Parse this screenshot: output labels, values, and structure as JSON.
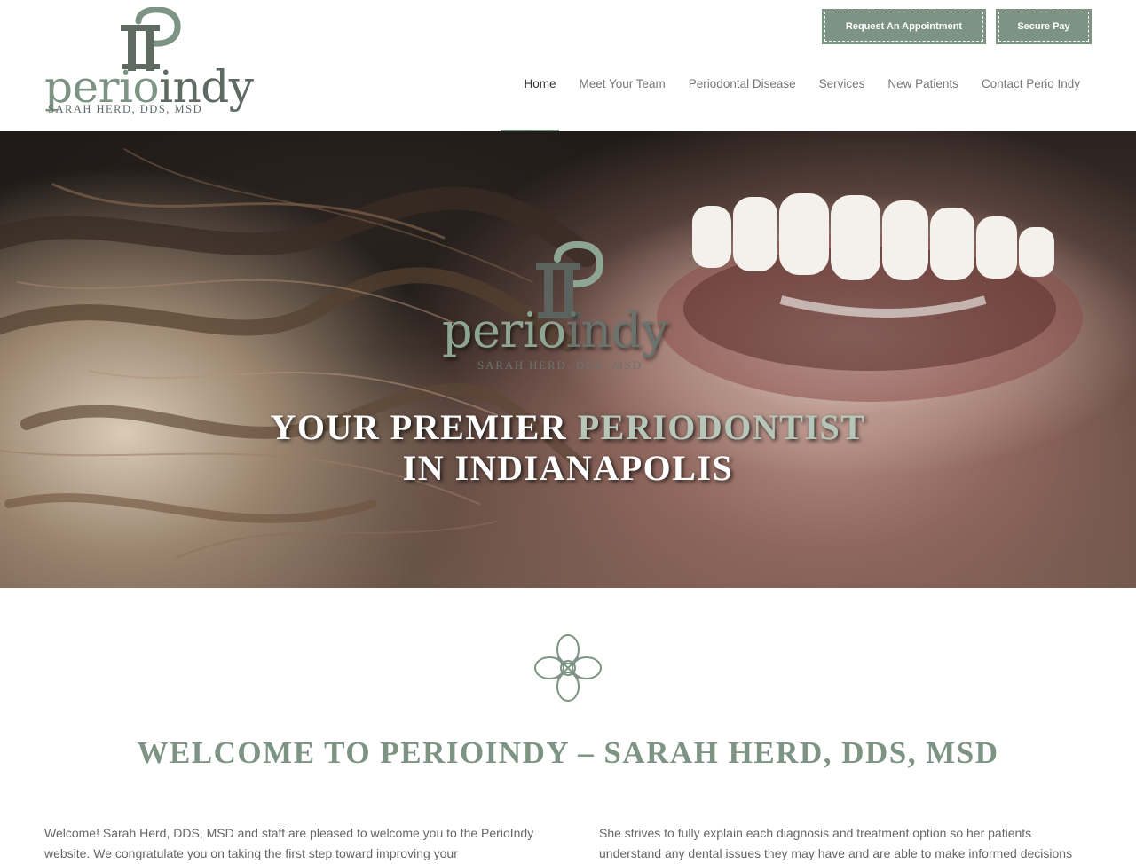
{
  "brand": {
    "logo_word_perio": "perio",
    "logo_word_indy": "indy",
    "logo_sub": "SARAH HERD, DDS, MSD",
    "primary_color": "#7d9384",
    "dark_color": "#5f6a63"
  },
  "header": {
    "appointment_label": "Request An Appointment",
    "secure_pay_label": "Secure Pay"
  },
  "nav": {
    "items": [
      {
        "label": "Home",
        "active": true
      },
      {
        "label": "Meet Your Team",
        "active": false
      },
      {
        "label": "Periodontal Disease",
        "active": false
      },
      {
        "label": "Services",
        "active": false
      },
      {
        "label": "New Patients",
        "active": false
      },
      {
        "label": "Contact Perio Indy",
        "active": false
      }
    ]
  },
  "hero": {
    "headline_part1": "YOUR PREMIER ",
    "headline_accent": "PERIODONTIST",
    "headline_line2": "IN INDIANAPOLIS",
    "image_icon": "smiling-woman-photo"
  },
  "welcome": {
    "ornament_icon": "celtic-knot-icon",
    "title": "WELCOME TO PERIOINDY – SARAH HERD, DDS, MSD",
    "left_text": "Welcome! Sarah Herd, DDS, MSD and staff are pleased to welcome you to the PerioIndy website. We congratulate you on taking the first step toward improving your",
    "right_text": "She strives to fully explain each diagnosis and treatment option so her patients understand any dental issues they may have and are able to make informed decisions"
  }
}
